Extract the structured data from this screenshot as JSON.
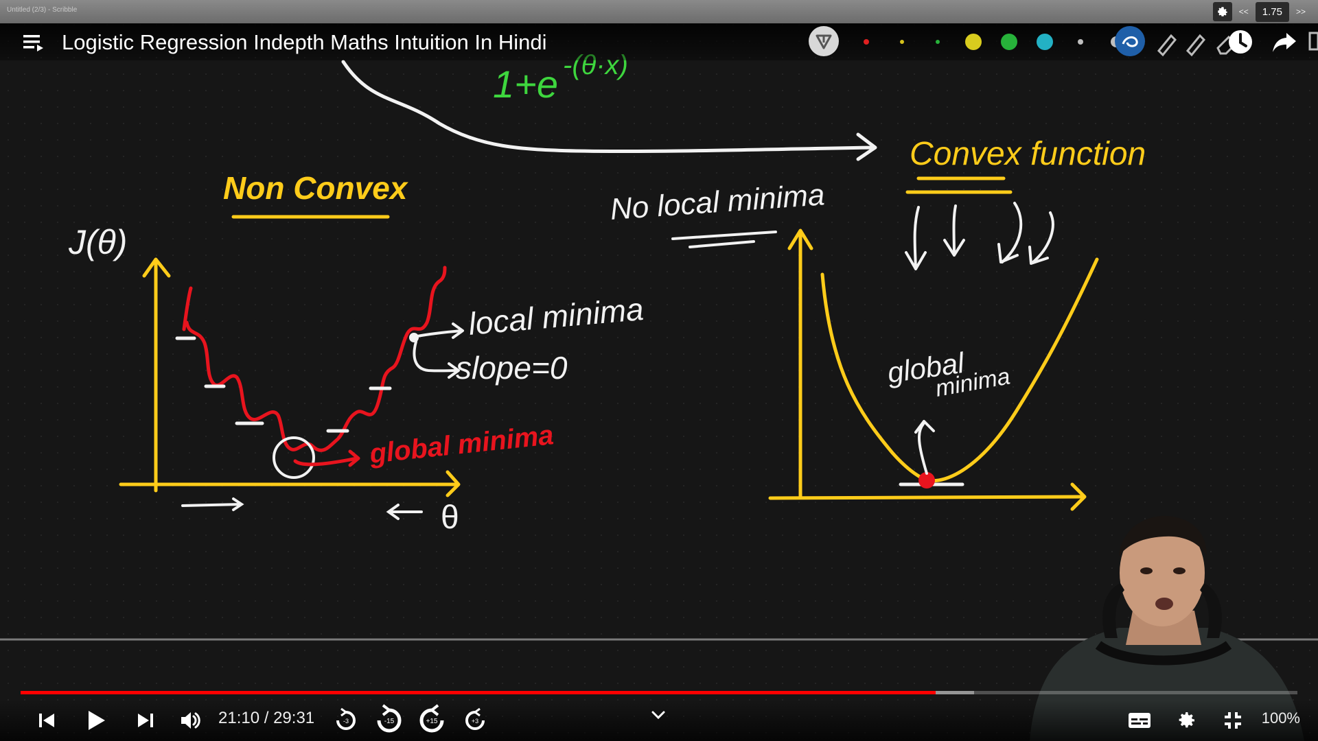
{
  "browser_tab": {
    "title": "Untitled (2/3) - Scribble"
  },
  "extension_speed": {
    "prev_label": "<<",
    "speed_value": "1.75",
    "next_label": ">>"
  },
  "video": {
    "title": "Logistic Regression Indepth Maths Intuition In Hindi"
  },
  "pen_toolbar": {
    "colors": [
      "#e02020",
      "#d6c21c",
      "#27b23a",
      "#d8cc1e",
      "#27b23a",
      "#23b1c4",
      "#bfbfbf",
      "#bfbfbf"
    ]
  },
  "whiteboard": {
    "formula_fragment": "1+e",
    "formula_exponent": "-(θ·x)",
    "non_convex_heading": "Non Convex",
    "y_axis_label": "J(θ)",
    "x_axis_label": "θ",
    "local_minima_label": "local minima",
    "slope_label": "slope=0",
    "global_minima_left_label": "global minima",
    "no_local_minima_label": "No local minima",
    "convex_heading": "Convex function",
    "global_label": "global",
    "minima_label": "minima"
  },
  "player": {
    "current_time": "21:10",
    "duration": "29:31",
    "time_separator": " / ",
    "progress_played": 0.7167,
    "progress_buffered": 0.7467,
    "rewind_3_label": "-3",
    "rewind_15_label": "-15",
    "forward_15_label": "+15",
    "forward_3_label": "+3",
    "zoom_label": "100%",
    "colors": {
      "played": "#ff0000",
      "accent": "#ffcc00",
      "ink_red": "#e8141e",
      "ink_green": "#3cd23c"
    }
  }
}
